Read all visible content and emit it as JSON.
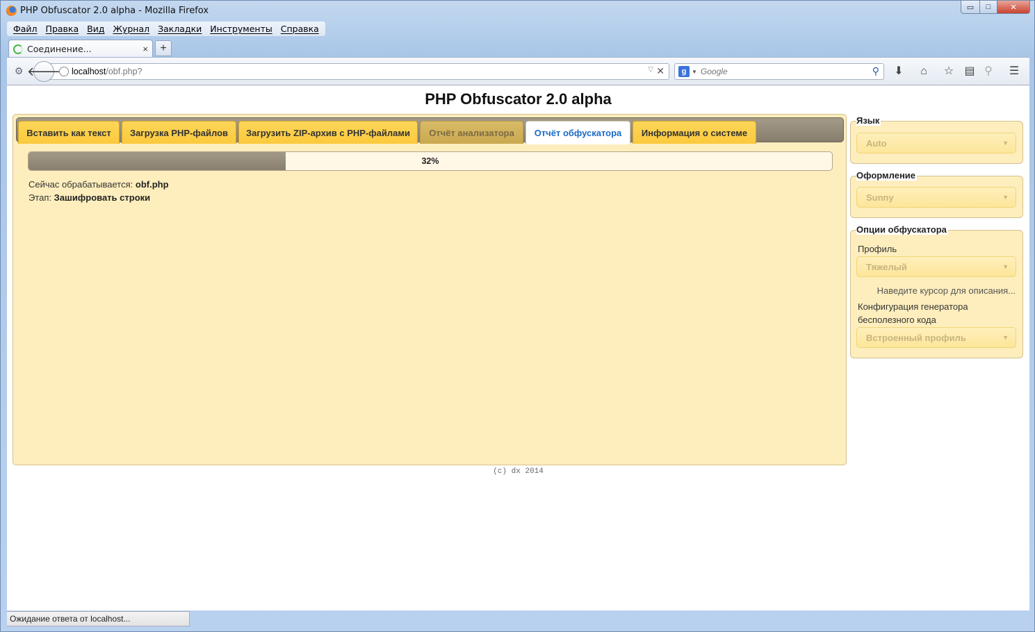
{
  "window": {
    "title": "PHP Obfuscator 2.0 alpha - Mozilla Firefox",
    "min_icon": "▭",
    "max_icon": "□",
    "close_icon": "✕"
  },
  "menubar": {
    "items": [
      "Файл",
      "Правка",
      "Вид",
      "Журнал",
      "Закладки",
      "Инструменты",
      "Справка"
    ]
  },
  "browser_tabs": {
    "active_label": "Соединение...",
    "close_glyph": "×",
    "newtab_glyph": "+"
  },
  "navbar": {
    "url_host": "localhost",
    "url_path": "/obf.php?",
    "search_placeholder": "Google",
    "search_engine_glyph": "g"
  },
  "page": {
    "title": "PHP Obfuscator 2.0 alpha",
    "tabs": [
      {
        "label": "Вставить как текст",
        "state": "normal"
      },
      {
        "label": "Загрузка PHP-файлов",
        "state": "normal"
      },
      {
        "label": "Загрузить ZIP-архив с PHP-файлами",
        "state": "normal"
      },
      {
        "label": "Отчёт анализатора",
        "state": "disabled"
      },
      {
        "label": "Отчёт обфускатора",
        "state": "active"
      },
      {
        "label": "Информация о системе",
        "state": "normal"
      }
    ],
    "progress": {
      "percent": 32,
      "label": "32%"
    },
    "processing_label": "Сейчас обрабатывается:",
    "processing_file": "obf.php",
    "stage_label": "Этап:",
    "stage_value": "Зашифровать строки",
    "footer": "(c) dx 2014"
  },
  "sidebar": {
    "language": {
      "legend": "Язык",
      "value": "Auto"
    },
    "theme": {
      "legend": "Оформление",
      "value": "Sunny"
    },
    "options": {
      "legend": "Опции обфускатора",
      "profile_label": "Профиль",
      "profile_value": "Тяжелый",
      "hover_hint": "Наведите курсор для описания...",
      "generator_label_line1": "Конфигурация генератора",
      "generator_label_line2": "бесполезного кода",
      "generator_value": "Встроенный профиль"
    }
  },
  "statusbar": {
    "text": "Ожидание ответа от localhost..."
  },
  "colors": {
    "tab_yellow": "#fbca3c",
    "panel_bg": "#feeebd",
    "active_tab_text": "#1a6bc6"
  }
}
